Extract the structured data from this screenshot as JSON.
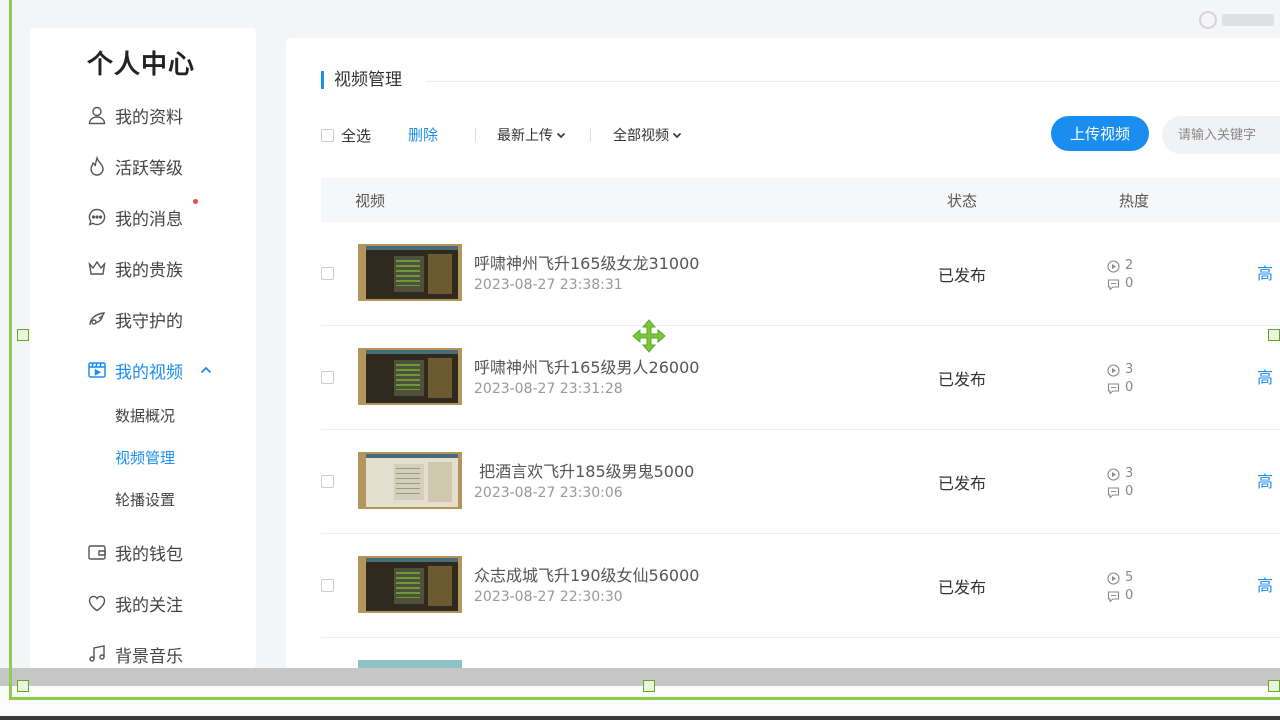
{
  "sidebar": {
    "title": "个人中心",
    "items": [
      {
        "label": "我的资料",
        "icon": "user-icon"
      },
      {
        "label": "活跃等级",
        "icon": "flame-icon"
      },
      {
        "label": "我的消息",
        "icon": "message-icon"
      },
      {
        "label": "我的贵族",
        "icon": "crown-icon"
      },
      {
        "label": "我守护的",
        "icon": "wing-icon"
      },
      {
        "label": "我的视频",
        "icon": "video-icon"
      },
      {
        "label": "我的钱包",
        "icon": "wallet-icon"
      },
      {
        "label": "我的关注",
        "icon": "heart-icon"
      },
      {
        "label": "背景音乐",
        "icon": "music-icon"
      }
    ],
    "sub_items": [
      "数据概况",
      "视频管理",
      "轮播设置"
    ]
  },
  "main": {
    "section_title": "视频管理",
    "toolbar": {
      "select_all": "全选",
      "delete": "删除",
      "sort_dropdown": "最新上传",
      "filter_dropdown": "全部视频",
      "upload_button": "上传视频",
      "search_placeholder": "请输入关键字"
    },
    "table": {
      "columns": [
        "视频",
        "状态",
        "热度"
      ],
      "rows": [
        {
          "title": "呼啸神州飞升165级女龙31000",
          "date": "2023-08-27 23:38:31",
          "status": "已发布",
          "plays": "2",
          "comments": "0",
          "action": "高"
        },
        {
          "title": "呼啸神州飞升165级男人26000",
          "date": "2023-08-27 23:31:28",
          "status": "已发布",
          "plays": "3",
          "comments": "0",
          "action": "高"
        },
        {
          "title": " 把酒言欢飞升185级男鬼5000",
          "date": "2023-08-27 23:30:06",
          "status": "已发布",
          "plays": "3",
          "comments": "0",
          "action": "高"
        },
        {
          "title": "众志成城飞升190级女仙56000",
          "date": "2023-08-27 22:30:30",
          "status": "已发布",
          "plays": "5",
          "comments": "0",
          "action": "高"
        }
      ]
    }
  },
  "colors": {
    "accent": "#1a8ef0",
    "selection_frame": "#8ccf4e",
    "notification_dot": "#f04848"
  }
}
